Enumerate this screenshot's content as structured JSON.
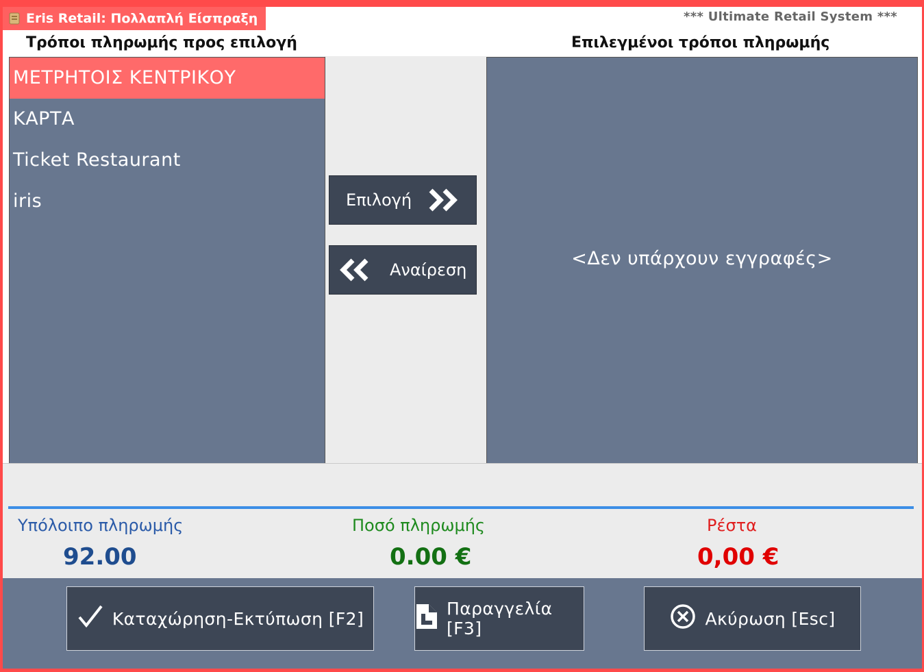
{
  "window": {
    "title": "Eris Retail: Πολλαπλή Είσπραξη",
    "subtitle": "*** Ultimate Retail System ***"
  },
  "headers": {
    "available": "Τρόποι πληρωμής προς επιλογή",
    "selected": "Επιλεγμένοι τρόποι πληρωμής"
  },
  "available_methods": [
    {
      "label": "ΜΕΤΡΗΤΟΙΣ ΚΕΝΤΡΙΚΟΥ",
      "selected": true
    },
    {
      "label": "ΚΑΡΤΑ",
      "selected": false
    },
    {
      "label": "Ticket Restaurant",
      "selected": false
    },
    {
      "label": "iris",
      "selected": false
    }
  ],
  "selected_methods": {
    "empty_message": "<Δεν υπάρχουν εγγραφές>"
  },
  "actions": {
    "select_label": "Επιλογή",
    "remove_label": "Αναίρεση"
  },
  "totals": {
    "remaining_label": "Υπόλοιπο πληρωμής",
    "remaining_value": "92.00",
    "payment_label": "Ποσό πληρωμής",
    "payment_value": "0.00 €",
    "change_label": "Ρέστα",
    "change_value": "0,00 €"
  },
  "footer": {
    "save_label": "Καταχώρηση-Εκτύπωση [F2]",
    "order_label": "Παραγγελία [F3]",
    "cancel_label": "Ακύρωση [Esc]"
  },
  "colors": {
    "accent_red": "#ff6060",
    "panel": "#68778f",
    "button": "#3d4655",
    "remaining": "#1f4d8f",
    "payment": "#137013",
    "change": "#e00000"
  },
  "icons": {
    "app": "receipt-scroll-icon",
    "select": "double-chevron-right-icon",
    "remove": "double-chevron-left-icon",
    "save": "checkmark-icon",
    "order": "document-icon",
    "cancel": "circle-x-icon"
  }
}
